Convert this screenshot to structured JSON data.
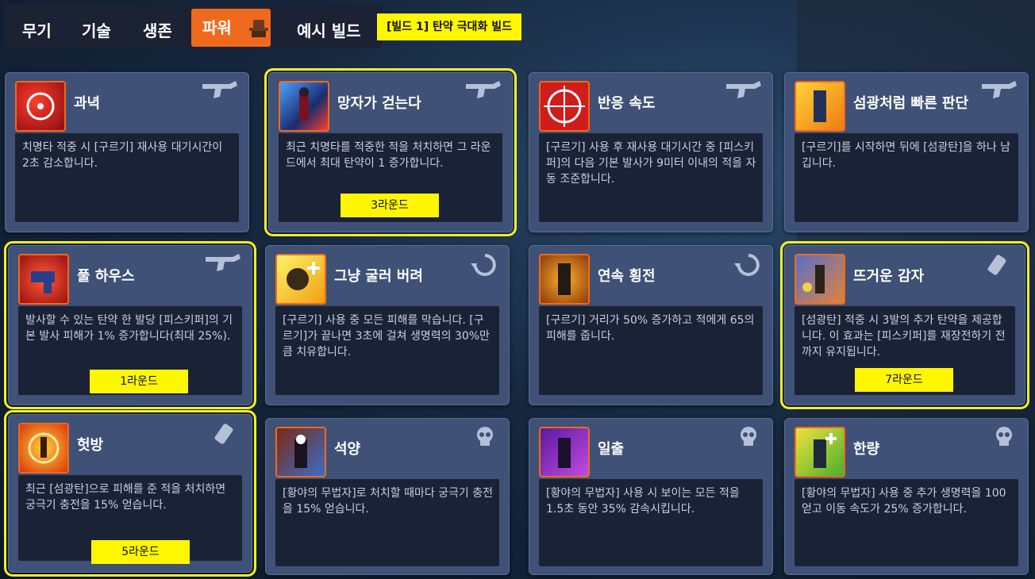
{
  "tabs": [
    {
      "label": "무기"
    },
    {
      "label": "기술"
    },
    {
      "label": "생존"
    },
    {
      "label": "파워"
    },
    {
      "label": "예시 빌드"
    }
  ],
  "build_label": "[빌드 1] 탄약 극대화 빌드",
  "colors": {
    "accent": "#ef6a1c",
    "highlight": "#f4ee22",
    "card": "#3f5176"
  },
  "cards": [
    {
      "title": "과녁",
      "icon": "revolver-icon",
      "desc": "치명타 적중 시 [구르기] 재사용 대기시간이 2초 감소합니다."
    },
    {
      "title": "망자가 걷는다",
      "icon": "revolver-icon",
      "desc": "최근 치명타를 적중한 적을 처치하면 그 라운드에서 최대 탄약이 1 증가합니다.",
      "round": "3라운드"
    },
    {
      "title": "반응 속도",
      "icon": "revolver-icon",
      "desc": "[구르기] 사용 후 재사용 대기시간 중 [피스키퍼]의 다음 기본 발사가 9미터 이내의 적을 자동 조준합니다."
    },
    {
      "title": "섬광처럼 빠른 판단",
      "icon": "revolver-icon",
      "desc": "[구르기]를 시작하면 뒤에 [섬광탄]을 하나 남깁니다."
    },
    {
      "title": "풀 하우스",
      "icon": "revolver-icon",
      "desc": "발사할 수 있는 탄약 한 발당 [피스키퍼]의 기본 발사 피해가 1% 증가합니다(최대 25%).",
      "round": "1라운드"
    },
    {
      "title": "그냥 굴러 버려",
      "icon": "roll-icon",
      "desc": "[구르기] 사용 중 모든 피해를 막습니다. [구르기]가 끝나면 3초에 걸쳐 생명력의 30%만큼 치유합니다."
    },
    {
      "title": "연속 횡전",
      "icon": "roll-icon",
      "desc": "[구르기] 거리가 50% 증가하고 적에게 65의 피해를 줍니다."
    },
    {
      "title": "뜨거운 감자",
      "icon": "flashbang-icon",
      "desc": "[섬광탄] 적중 시 3발의 추가 탄약을 제공합니다. 이 효과는 [피스키퍼]를 재장전하기 전까지 유지됩니다.",
      "round": "7라운드"
    },
    {
      "title": "헛방",
      "icon": "flashbang-icon",
      "desc": "최근 [섬광탄]으로 피해를 준 적을 처치하면 궁극기 충전을 15% 얻습니다.",
      "round": "5라운드"
    },
    {
      "title": "석양",
      "icon": "skull-icon",
      "desc": "[황야의 무법자]로 처치할 때마다 궁극기 충전을 15% 얻습니다."
    },
    {
      "title": "일출",
      "icon": "skull-icon",
      "desc": "[황야의 무법자] 사용 시 보이는 모든 적을 1.5초 동안 35% 감속시킵니다."
    },
    {
      "title": "한량",
      "icon": "skull-icon",
      "desc": "[황야의 무법자] 사용 중 추가 생명력을 100 얻고 이동 속도가 25% 증가합니다."
    }
  ]
}
